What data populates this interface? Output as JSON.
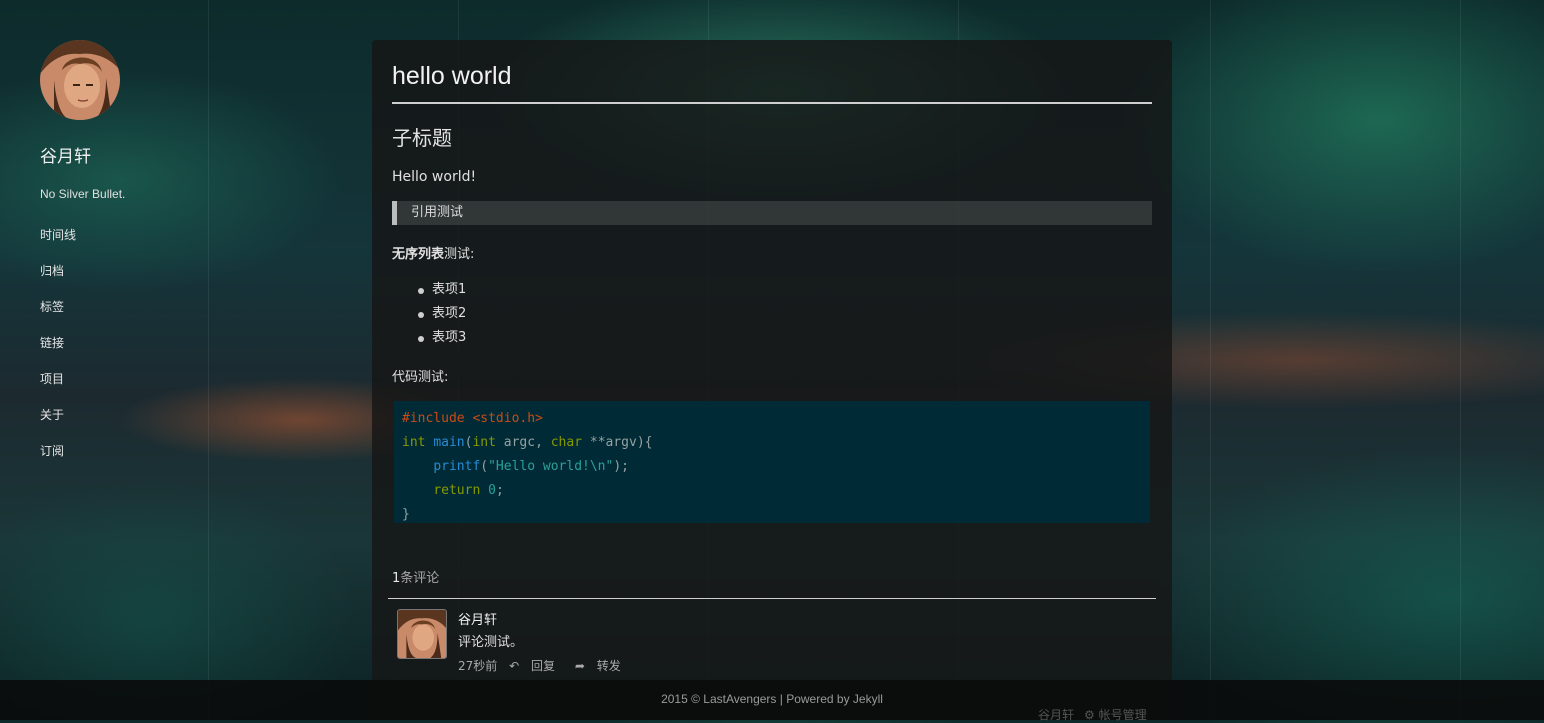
{
  "sidebar": {
    "site_name": "谷月轩",
    "motto": "No Silver Bullet.",
    "nav": [
      "时间线",
      "归档",
      "标签",
      "链接",
      "项目",
      "关于",
      "订阅"
    ]
  },
  "post": {
    "title": "hello world",
    "subtitle": "子标题",
    "paragraph": "Hello world!",
    "quote": "引用测试",
    "list_heading_bold": "无序列表",
    "list_heading_rest": "测试:",
    "list_items": [
      "表项1",
      "表项2",
      "表项3"
    ],
    "code_label": "代码测试:",
    "code": {
      "l1": "#include <stdio.h>",
      "l2_type": "int",
      "l2_fn": "main",
      "l2_int": "int",
      "l2_argc": " argc, ",
      "l2_char": "char",
      "l2_rest": " **argv){",
      "l3_fn": "printf",
      "l3_str": "\"Hello world!\\n\"",
      "l4_kw": "return",
      "l4_num": "0",
      "l5": "}"
    }
  },
  "comments": {
    "count": "1",
    "count_label": "条评论",
    "items": [
      {
        "author": "谷月轩",
        "text": "评论测试。",
        "time": "27秒前",
        "reply": "回复",
        "share": "转发"
      }
    ]
  },
  "footer": {
    "text": "2015 © LastAvengers | Powered by Jekyll",
    "user": "谷月轩",
    "manage": "帐号管理"
  },
  "colors": {
    "code_bg": "#002b36",
    "code_keyword": "#859900",
    "code_function": "#268bd2",
    "code_string": "#2aa198",
    "code_preprocessor": "#cb4b16"
  }
}
